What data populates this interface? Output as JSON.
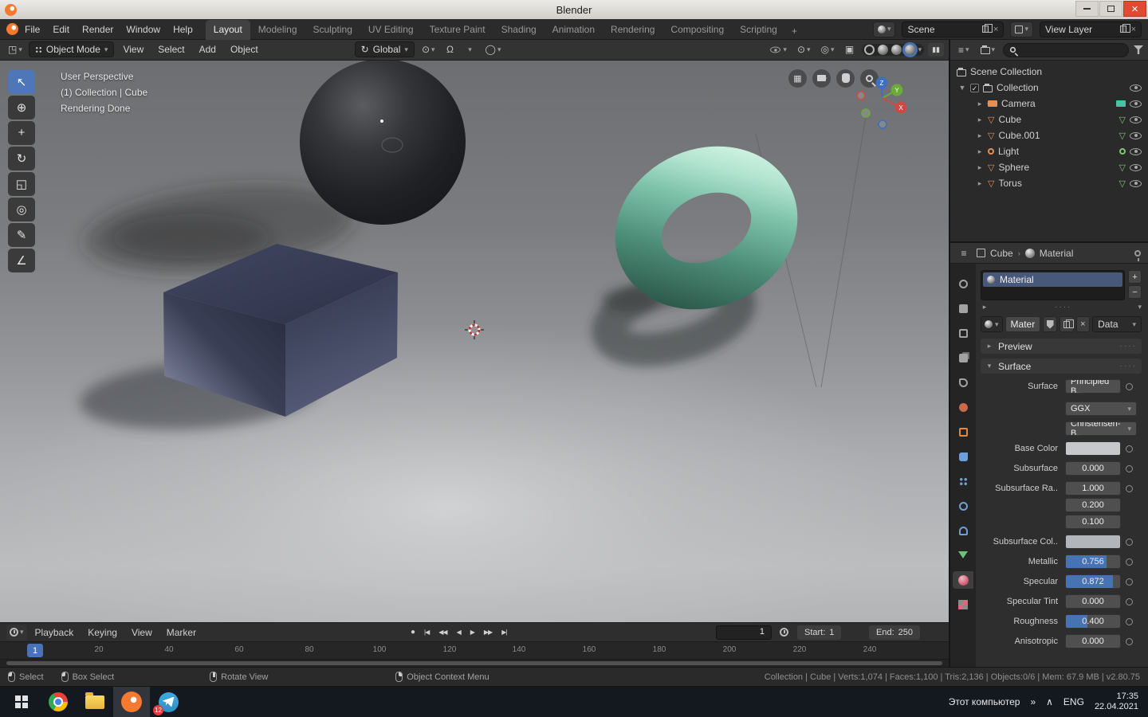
{
  "glyphs": {
    "chev_down": "▾",
    "chev_right": "▸",
    "tri_down": "▼",
    "crumb_sep": "›",
    "close": "×",
    "plus": "+",
    "minus": "−",
    "grip": "····",
    "record": "●",
    "pause": "▮▮",
    "check": "✓",
    "mesh": "▽",
    "magnet": "Ω",
    "prop_circle": "◯",
    "overlay_ic": "◎",
    "gizmo_ic": "⊙",
    "pivot_ic": "⊙",
    "grid_ic": "▦",
    "editor_3d": "◳",
    "editor_list": "≡",
    "orient_ic": "↻",
    "xray_ic": "▣"
  },
  "window": {
    "title": "Blender"
  },
  "topbar": {
    "menus": [
      "File",
      "Edit",
      "Render",
      "Window",
      "Help"
    ],
    "workspaces": [
      "Layout",
      "Modeling",
      "Sculpting",
      "UV Editing",
      "Texture Paint",
      "Shading",
      "Animation",
      "Rendering",
      "Compositing",
      "Scripting"
    ],
    "add_tab": "+",
    "scene_value": "Scene",
    "view_layer_value": "View Layer"
  },
  "vp_header": {
    "mode": "Object Mode",
    "menus": [
      "View",
      "Select",
      "Add",
      "Object"
    ],
    "orientation": "Global"
  },
  "tools": [
    "↖",
    "⊕",
    "+",
    "↻",
    "◱",
    "◎",
    "✎",
    "∠"
  ],
  "viewport": {
    "overlay": [
      "User Perspective",
      "(1) Collection | Cube",
      "Rendering Done"
    ],
    "axis_x": "X",
    "axis_y": "Y",
    "axis_z": "Z"
  },
  "outliner": {
    "root": "Scene Collection",
    "items": [
      {
        "label": "Collection"
      },
      {
        "label": "Camera"
      },
      {
        "label": "Cube"
      },
      {
        "label": "Cube.001"
      },
      {
        "label": "Light"
      },
      {
        "label": "Sphere"
      },
      {
        "label": "Torus"
      }
    ]
  },
  "properties": {
    "breadcrumb_object": "Cube",
    "breadcrumb_material": "Material",
    "slot_name": "Material",
    "datablock_name": "Mater",
    "link_label": "Data",
    "preview_label": "Preview",
    "surface_section": "Surface",
    "surface": {
      "label": "Surface",
      "shader": "Principled B..",
      "distribution": "GGX",
      "method": "Christensen-B.."
    },
    "fields": {
      "base_color": {
        "label": "Base Color"
      },
      "subsurface": {
        "label": "Subsurface",
        "value": "0.000",
        "fill": 0
      },
      "subsurface_radius": {
        "label": "Subsurface Ra..",
        "v1": "1.000",
        "v2": "0.200",
        "v3": "0.100"
      },
      "subsurface_color": {
        "label": "Subsurface Col.."
      },
      "metallic": {
        "label": "Metallic",
        "value": "0.756",
        "fill": 0.756
      },
      "specular": {
        "label": "Specular",
        "value": "0.872",
        "fill": 0.872
      },
      "specular_tint": {
        "label": "Specular Tint",
        "value": "0.000",
        "fill": 0
      },
      "roughness": {
        "label": "Roughness",
        "value": "0.400",
        "fill": 0.4
      },
      "anisotropic": {
        "label": "Anisotropic",
        "value": "0.000",
        "fill": 0
      }
    }
  },
  "timeline": {
    "menus": [
      "Playback",
      "Keying",
      "View",
      "Marker"
    ],
    "transport": [
      "|◀",
      "◀◀",
      "◀",
      "▶",
      "▶▶",
      "▶|"
    ],
    "frame": "1",
    "start_label": "Start:",
    "start_value": "1",
    "end_label": "End:",
    "end_value": "250",
    "current": "1",
    "ticks": [
      "20",
      "40",
      "60",
      "80",
      "100",
      "120",
      "140",
      "160",
      "180",
      "200",
      "220",
      "240"
    ]
  },
  "statusbar": {
    "hints": [
      "Select",
      "Box Select",
      "Rotate View",
      "Object Context Menu"
    ],
    "stats": "Collection | Cube | Verts:1,074 | Faces:1,100 | Tris:2,136 | Objects:0/6 | Mem: 67.9 MB | v2.80.75"
  },
  "taskbar": {
    "tray_label": "Этот компьютер",
    "overflow": "»",
    "tray_up": "∧",
    "lang": "ENG",
    "time": "17:35",
    "date": "22.04.2021",
    "badge": "12"
  }
}
